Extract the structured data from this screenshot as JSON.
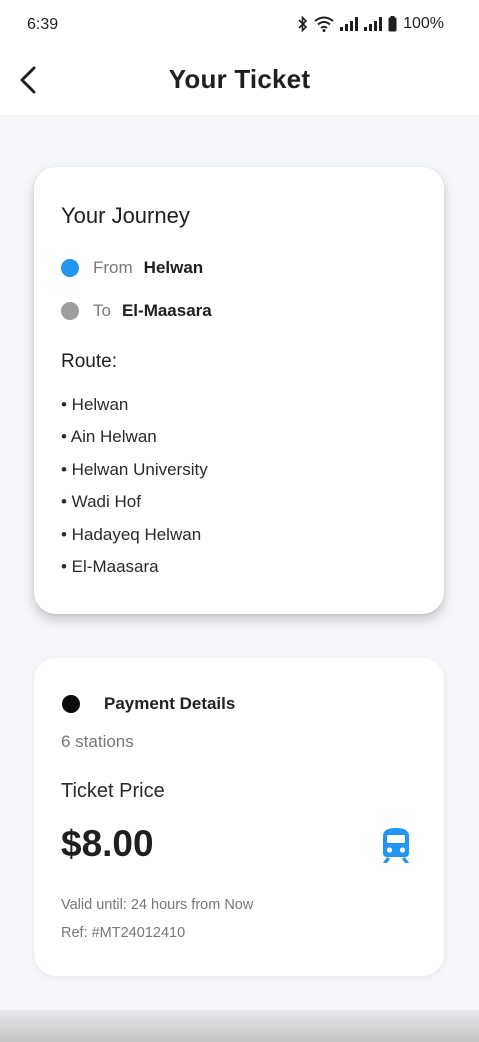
{
  "status_bar": {
    "time": "6:39",
    "battery": "100%"
  },
  "header": {
    "title": "Your Ticket"
  },
  "journey": {
    "title": "Your Journey",
    "from_label": "From",
    "from_station": "Helwan",
    "to_label": "To",
    "to_station": "El-Maasara",
    "route_heading": "Route:",
    "route": [
      "• Helwan",
      "• Ain Helwan",
      "• Helwan University",
      "• Wadi Hof",
      "• Hadayeq Helwan",
      "• El-Maasara"
    ]
  },
  "payment": {
    "title": "Payment Details",
    "stations": "6 stations",
    "price_label": "Ticket Price",
    "price": "$8.00",
    "valid_until": "Valid until: 24 hours from Now",
    "reference": "Ref: #MT24012410"
  },
  "colors": {
    "accent": "#2196f3",
    "muted_dot": "#9e9e9e",
    "background": "#f5f6fa"
  },
  "icons": [
    "back-arrow",
    "bluetooth",
    "wifi",
    "signal",
    "battery",
    "train"
  ]
}
